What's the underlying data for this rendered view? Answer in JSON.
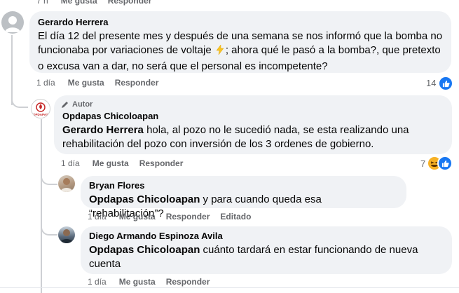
{
  "top_partial": {
    "time": "7 h",
    "like": "Me gusta",
    "reply": "Responder"
  },
  "comment1": {
    "author": "Gerardo Herrera",
    "text_before_emoji": "El día 12 del presente mes y después de una semana se nos informó que la bomba no funcionaba por variaciones de voltaje",
    "text_after_emoji": "; ahora qué le pasó a la bomba?, que pretexto o excusa van a dar, no será que el personal es incompetente?",
    "time": "1 día",
    "like": "Me gusta",
    "reply": "Responder",
    "reaction_count": "14",
    "emoji": "lightning-emoji",
    "reaction_icon": "like-icon"
  },
  "comment2": {
    "badge": "Autor",
    "author": "Opdapas Chicoloapan",
    "mention": "Gerardo Herrera",
    "text": " hola, al pozo no le sucedió nada, se esta realizando una rehabilitación del pozo con inversión de los 3 ordenes de gobierno.",
    "time": "1 día",
    "like": "Me gusta",
    "reply": "Responder",
    "reaction_count": "7",
    "reaction_icons": [
      "haha-icon",
      "like-icon"
    ],
    "avatar_text": "OPDAPAS"
  },
  "comment3": {
    "author": "Bryan Flores",
    "mention": "Opdapas Chicoloapan",
    "text": " y para cuando queda esa “rehabilitación”?",
    "time": "1 día",
    "like": "Me gusta",
    "reply": "Responder",
    "edited": "Editado"
  },
  "comment4": {
    "author": "Diego Armando Espinoza Avila",
    "mention": "Opdapas Chicoloapan",
    "text": " cuánto tardará en estar funcionando de nueva cuenta",
    "time": "1 día",
    "like": "Me gusta",
    "reply": "Responder"
  },
  "colors": {
    "bubble": "#f0f2f5",
    "meta": "#65676b",
    "like_blue": "#1877f2",
    "haha_yellow": "#f7b125"
  }
}
